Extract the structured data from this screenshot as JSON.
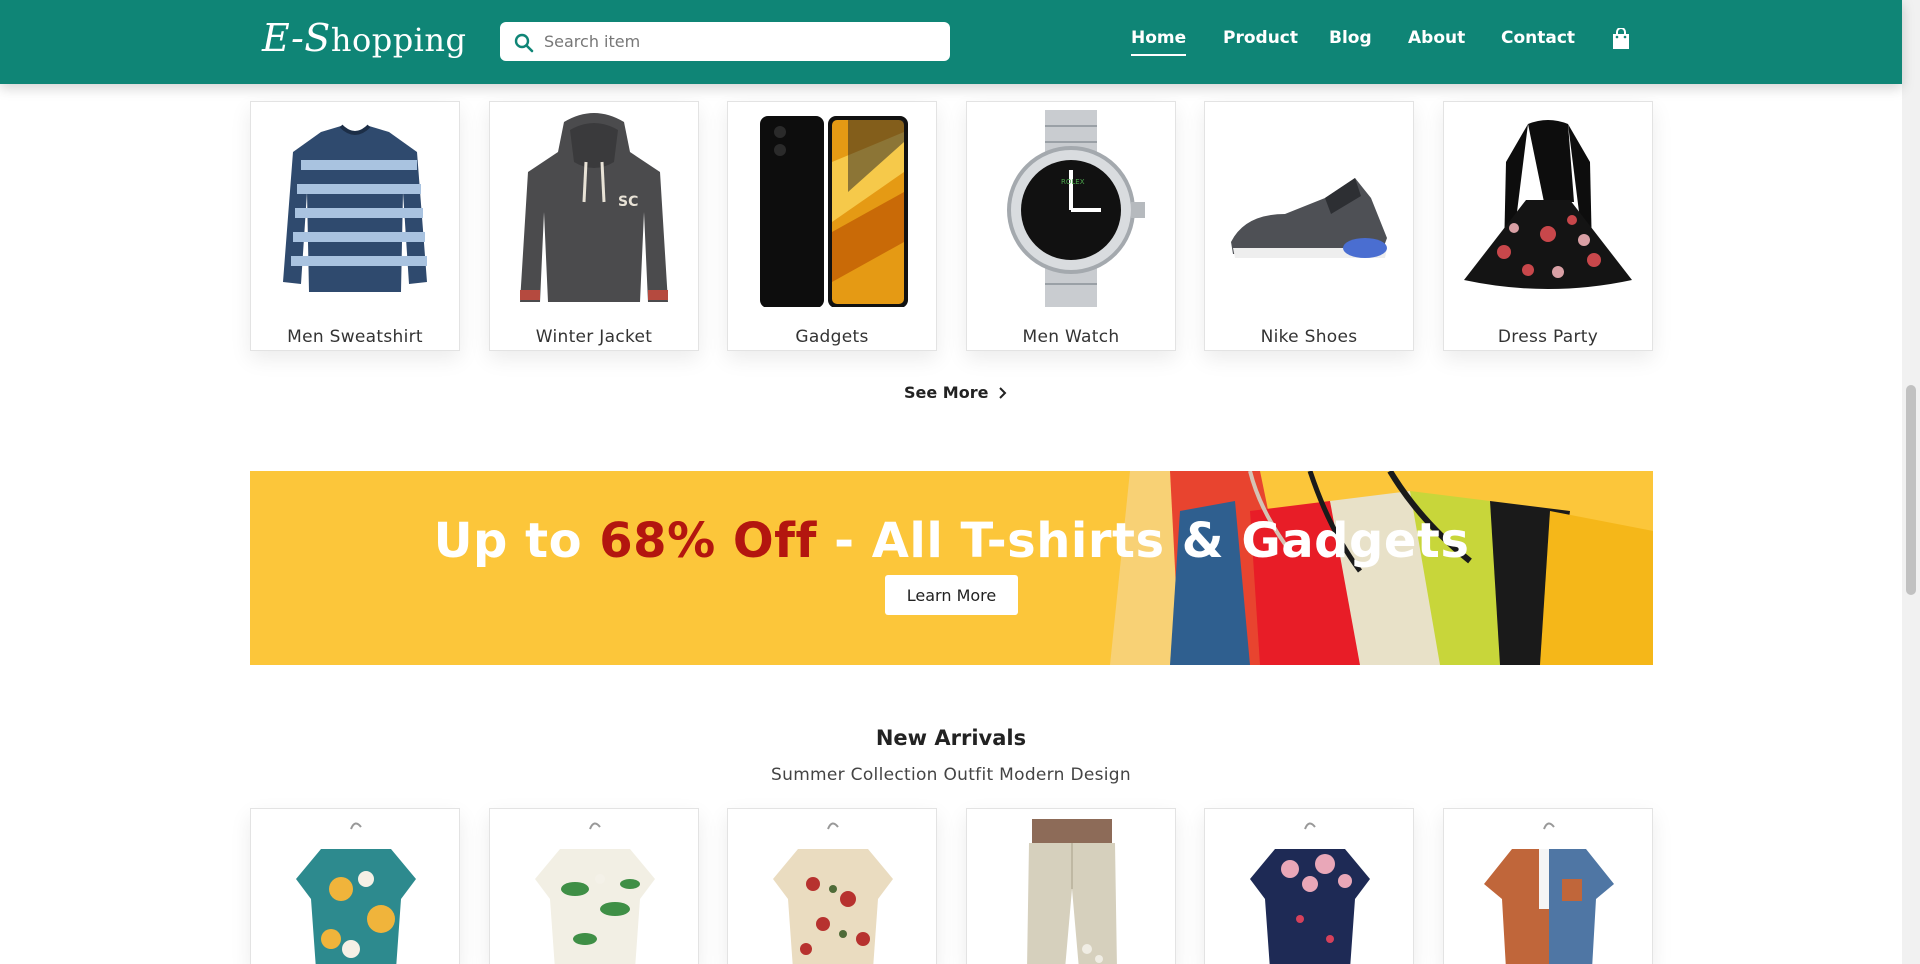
{
  "header": {
    "logo": {
      "first": "E-S",
      "rest": "hopping"
    },
    "search": {
      "placeholder": "Search item",
      "value": ""
    },
    "nav": [
      {
        "label": "Home",
        "active": true
      },
      {
        "label": "Product",
        "active": false
      },
      {
        "label": "Blog",
        "active": false
      },
      {
        "label": "About",
        "active": false
      },
      {
        "label": "Contact",
        "active": false
      }
    ],
    "cart_icon": "shopping-bag-icon"
  },
  "categories": [
    {
      "label": "Men Sweatshirt"
    },
    {
      "label": "Winter Jacket"
    },
    {
      "label": "Gadgets"
    },
    {
      "label": "Men Watch"
    },
    {
      "label": "Nike Shoes"
    },
    {
      "label": "Dress Party"
    }
  ],
  "see_more": {
    "label": "See More"
  },
  "banner": {
    "title_pre": "Up to ",
    "title_highlight": "68% Off",
    "title_post": " - All T-shirts & Gadgets",
    "button": "Learn More",
    "colors": {
      "background": "#fcc63a",
      "highlight": "#b3160f"
    }
  },
  "new_arrivals": {
    "title": "New Arrivals",
    "subtitle": "Summer Collection Outfit Modern Design"
  },
  "colors": {
    "brand": "#0f8576"
  }
}
